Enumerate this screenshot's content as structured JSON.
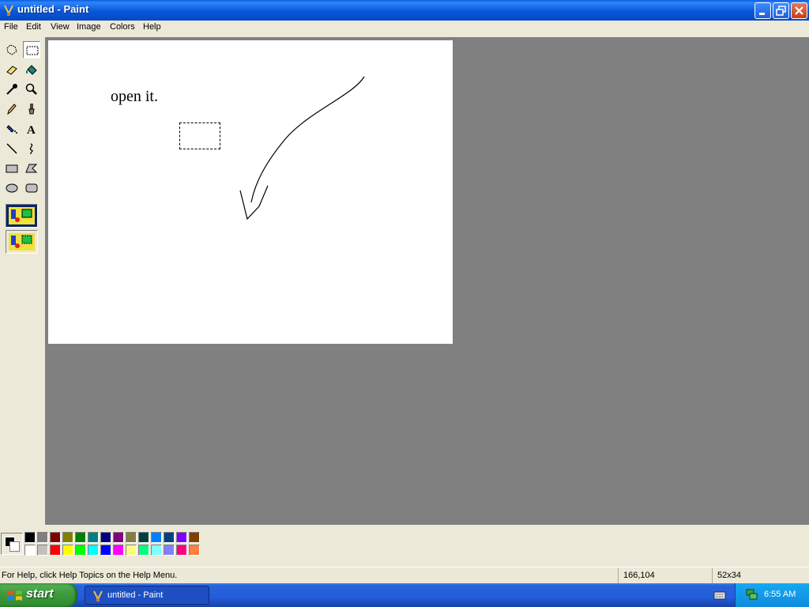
{
  "window": {
    "title": "untitled - Paint",
    "icon": "paint-brush-icon"
  },
  "menu": [
    "File",
    "Edit",
    "View",
    "Image",
    "Colors",
    "Help"
  ],
  "tools": [
    {
      "name": "free-form-select-icon"
    },
    {
      "name": "select-icon",
      "selected": true
    },
    {
      "name": "eraser-icon"
    },
    {
      "name": "fill-bucket-icon"
    },
    {
      "name": "pick-color-icon"
    },
    {
      "name": "magnifier-icon"
    },
    {
      "name": "pencil-icon"
    },
    {
      "name": "brush-icon"
    },
    {
      "name": "airbrush-icon"
    },
    {
      "name": "text-icon"
    },
    {
      "name": "line-icon"
    },
    {
      "name": "curve-icon"
    },
    {
      "name": "rectangle-icon"
    },
    {
      "name": "polygon-icon"
    },
    {
      "name": "ellipse-icon"
    },
    {
      "name": "rounded-rectangle-icon"
    }
  ],
  "canvas": {
    "text": "open it."
  },
  "palette": {
    "foreground": "#000000",
    "background": "#FFFFFF",
    "colors": [
      "#000000",
      "#808080",
      "#800000",
      "#808000",
      "#008000",
      "#008080",
      "#000080",
      "#800080",
      "#808040",
      "#004040",
      "#0080FF",
      "#004080",
      "#8000FF",
      "#804000",
      "#FFFFFF",
      "#C0C0C0",
      "#FF0000",
      "#FFFF00",
      "#00FF00",
      "#00FFFF",
      "#0000FF",
      "#FF00FF",
      "#FFFF80",
      "#00FF80",
      "#80FFFF",
      "#8080FF",
      "#FF0080",
      "#FF8040"
    ]
  },
  "status": {
    "help": "For Help, click Help Topics on the Help Menu.",
    "position": "166,104",
    "size": "52x34"
  },
  "taskbar": {
    "start": "start",
    "task": "untitled - Paint",
    "clock": "6:55 AM"
  }
}
